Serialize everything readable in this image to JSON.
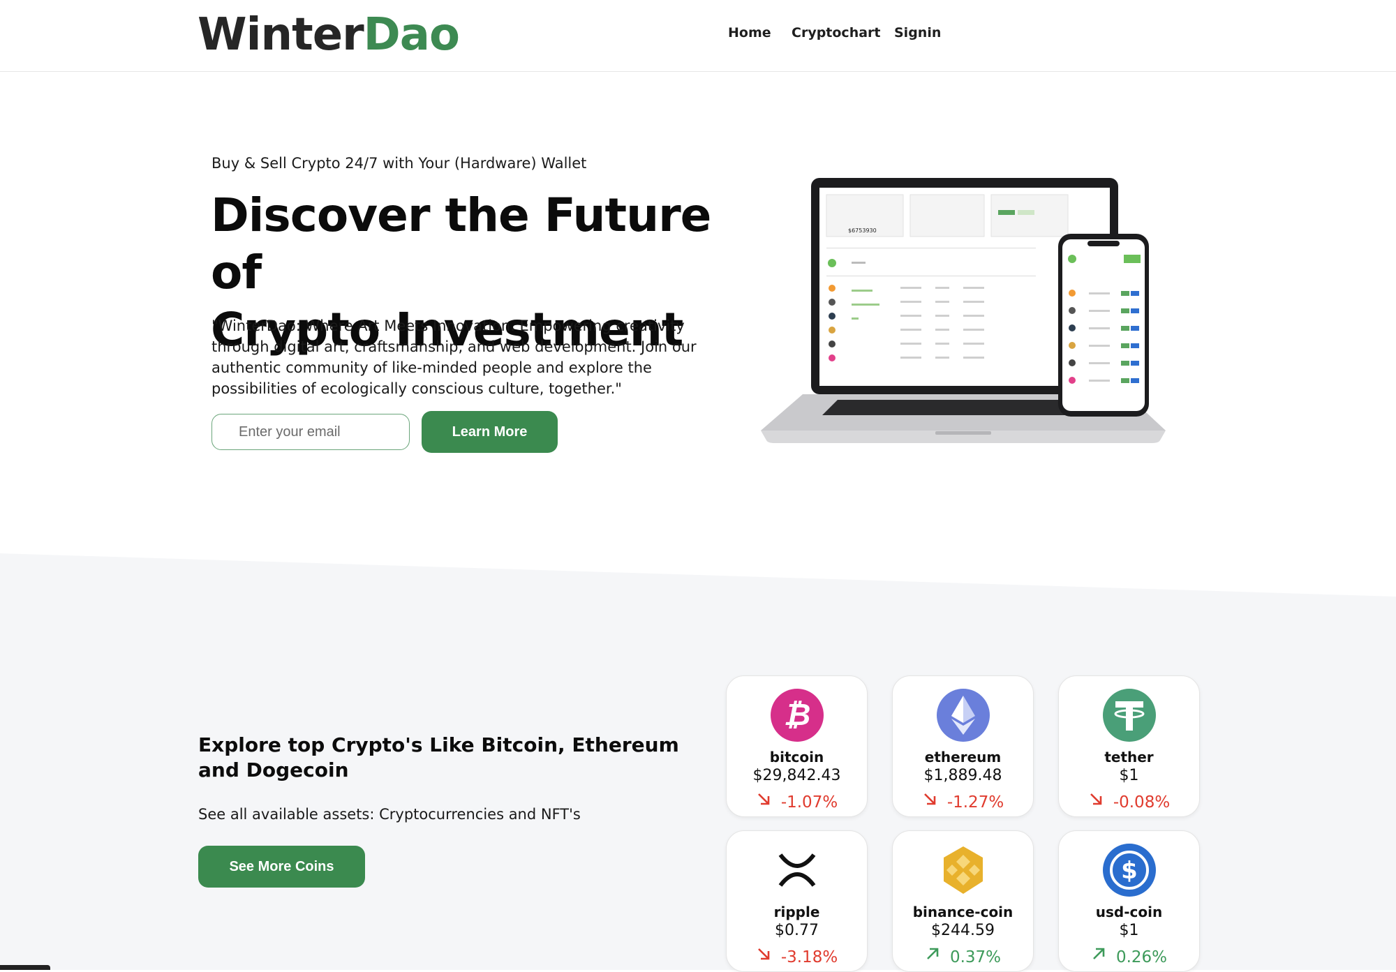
{
  "header": {
    "logo_part1": "Winter",
    "logo_part2": "Dao",
    "nav": [
      "Home",
      "Cryptochart",
      "Signin"
    ]
  },
  "hero": {
    "eyebrow": "Buy & Sell Crypto 24/7 with Your (Hardware) Wallet",
    "title_line1": "Discover the Future of",
    "title_line2": "Crypto Investment",
    "description": "\"WinterDao: Where Art Meets Innovation. Empowering creativity through digital art, craftsmanship, and web development. Join our authentic community of like-minded people and explore the possibilities of ecologically conscious culture, together.\"",
    "email_placeholder": "Enter your email",
    "cta_label": "Learn More"
  },
  "mockup": {
    "laptop_balance": "$6753930"
  },
  "explore": {
    "title": "Explore top Crypto's Like Bitcoin, Ethereum and Dogecoin",
    "subtitle": "See all available assets: Cryptocurrencies and NFT's",
    "button_label": "See More Coins"
  },
  "coins": [
    {
      "name": "bitcoin",
      "price": "$29,842.43",
      "change": "-1.07%",
      "direction": "down",
      "icon": "bitcoin-icon",
      "color": "#d62f8a"
    },
    {
      "name": "ethereum",
      "price": "$1,889.48",
      "change": "-1.27%",
      "direction": "down",
      "icon": "ethereum-icon",
      "color": "#6a7fdb"
    },
    {
      "name": "tether",
      "price": "$1",
      "change": "-0.08%",
      "direction": "down",
      "icon": "tether-icon",
      "color": "#4a9f78"
    },
    {
      "name": "ripple",
      "price": "$0.77",
      "change": "-3.18%",
      "direction": "down",
      "icon": "ripple-icon",
      "color": "#111111"
    },
    {
      "name": "binance-coin",
      "price": "$244.59",
      "change": "0.37%",
      "direction": "up",
      "icon": "binance-coin-icon",
      "color": "#e8b12c"
    },
    {
      "name": "usd-coin",
      "price": "$1",
      "change": "0.26%",
      "direction": "up",
      "icon": "usd-coin-icon",
      "color": "#2a6dce"
    }
  ],
  "colors": {
    "accent": "#3b8a4f",
    "negative": "#e03b2e",
    "positive": "#3d9a5a",
    "section_bg": "#f5f6f8"
  }
}
